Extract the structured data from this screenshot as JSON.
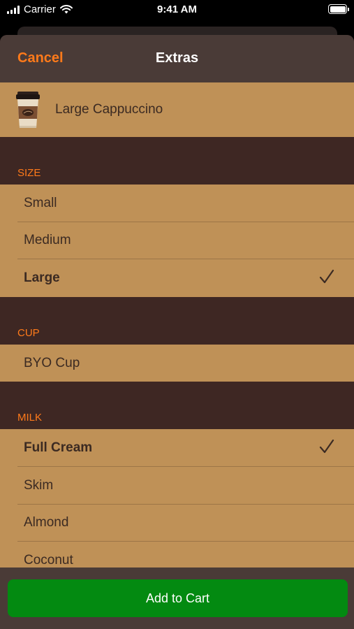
{
  "status_bar": {
    "carrier": "Carrier",
    "time": "9:41 AM"
  },
  "nav": {
    "cancel_label": "Cancel",
    "title": "Extras"
  },
  "product": {
    "name": "Large Cappuccino",
    "icon": "coffee-cup-icon"
  },
  "sections": [
    {
      "title": "SIZE",
      "options": [
        {
          "label": "Small",
          "selected": false
        },
        {
          "label": "Medium",
          "selected": false
        },
        {
          "label": "Large",
          "selected": true
        }
      ]
    },
    {
      "title": "CUP",
      "options": [
        {
          "label": "BYO Cup",
          "selected": false
        }
      ]
    },
    {
      "title": "MILK",
      "options": [
        {
          "label": "Full Cream",
          "selected": true
        },
        {
          "label": "Skim",
          "selected": false
        },
        {
          "label": "Almond",
          "selected": false
        },
        {
          "label": "Coconut",
          "selected": false
        }
      ]
    }
  ],
  "footer": {
    "add_to_cart_label": "Add to Cart"
  },
  "colors": {
    "accent": "#ff7a1a",
    "background": "#3e2723",
    "row": "#bf9157",
    "button": "#038a11"
  }
}
